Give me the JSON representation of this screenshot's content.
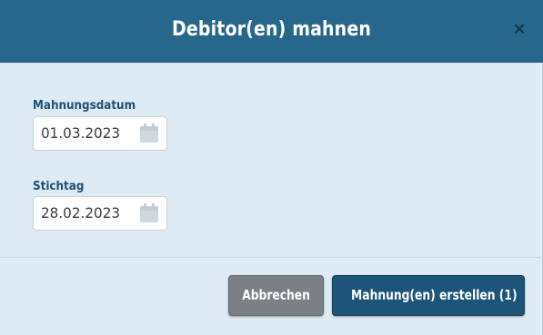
{
  "dialog": {
    "title": "Debitor(en) mahnen",
    "close_icon": "close-icon"
  },
  "fields": {
    "mahnungsdatum": {
      "label": "Mahnungsdatum",
      "value": "01.03.2023",
      "icon": "calendar-icon"
    },
    "stichtag": {
      "label": "Stichtag",
      "value": "28.02.2023",
      "icon": "calendar-icon"
    }
  },
  "footer": {
    "cancel_label": "Abbrechen",
    "create_label": "Mahnung(en) erstellen (1)"
  },
  "colors": {
    "header": "#28678c",
    "body": "#deeaf4",
    "label": "#1e4f73",
    "cancel_button": "#7a8086",
    "primary_button": "#1d5478"
  }
}
